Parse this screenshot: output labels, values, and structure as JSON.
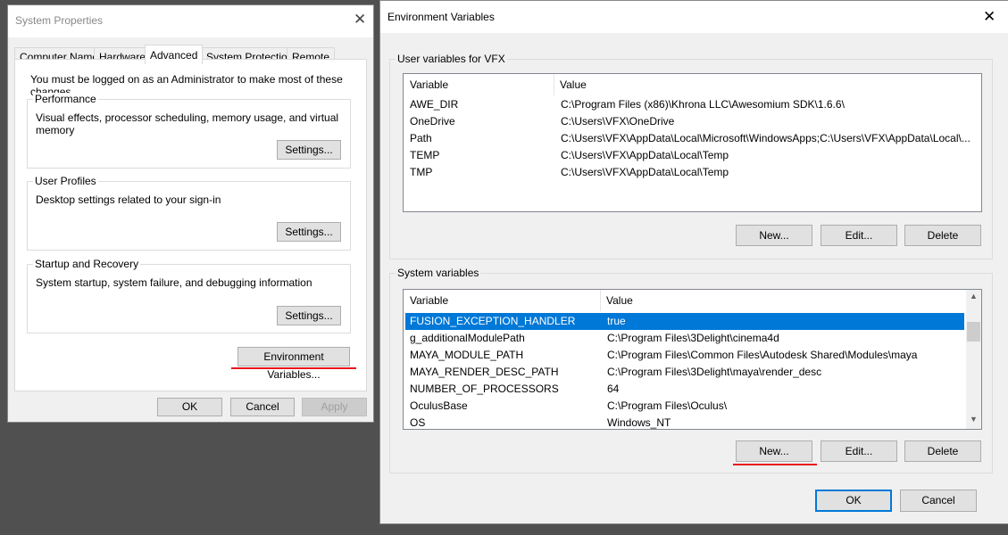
{
  "system_properties": {
    "title": "System Properties",
    "tabs": [
      "Computer Name",
      "Hardware",
      "Advanced",
      "System Protection",
      "Remote"
    ],
    "selected_tab": "Advanced",
    "admin_note": "You must be logged on as an Administrator to make most of these changes.",
    "performance": {
      "label": "Performance",
      "desc": "Visual effects, processor scheduling, memory usage, and virtual memory",
      "button": "Settings..."
    },
    "user_profiles": {
      "label": "User Profiles",
      "desc": "Desktop settings related to your sign-in",
      "button": "Settings..."
    },
    "startup": {
      "label": "Startup and Recovery",
      "desc": "System startup, system failure, and debugging information",
      "button": "Settings..."
    },
    "env_button": "Environment Variables...",
    "ok": "OK",
    "cancel": "Cancel",
    "apply": "Apply"
  },
  "env_vars": {
    "title": "Environment Variables",
    "user_group": "User variables for VFX",
    "columns": [
      "Variable",
      "Value"
    ],
    "user_vars": [
      [
        "AWE_DIR",
        "C:\\Program Files (x86)\\Khrona LLC\\Awesomium SDK\\1.6.6\\"
      ],
      [
        "OneDrive",
        "C:\\Users\\VFX\\OneDrive"
      ],
      [
        "Path",
        "C:\\Users\\VFX\\AppData\\Local\\Microsoft\\WindowsApps;C:\\Users\\VFX\\AppData\\Local\\..."
      ],
      [
        "TEMP",
        "C:\\Users\\VFX\\AppData\\Local\\Temp"
      ],
      [
        "TMP",
        "C:\\Users\\VFX\\AppData\\Local\\Temp"
      ]
    ],
    "system_group": "System variables",
    "system_vars": [
      [
        "FUSION_EXCEPTION_HANDLER",
        "true"
      ],
      [
        "g_additionalModulePath",
        "C:\\Program Files\\3Delight\\cinema4d"
      ],
      [
        "MAYA_MODULE_PATH",
        "C:\\Program Files\\Common Files\\Autodesk Shared\\Modules\\maya"
      ],
      [
        "MAYA_RENDER_DESC_PATH",
        "C:\\Program Files\\3Delight\\maya\\render_desc"
      ],
      [
        "NUMBER_OF_PROCESSORS",
        "64"
      ],
      [
        "OculusBase",
        "C:\\Program Files\\Oculus\\"
      ],
      [
        "OS",
        "Windows_NT"
      ]
    ],
    "selected_system_var": "FUSION_EXCEPTION_HANDLER",
    "new": "New...",
    "edit": "Edit...",
    "delete": "Delete",
    "ok": "OK",
    "cancel": "Cancel"
  },
  "colors": {
    "selection": "#0078d7",
    "highlight_underline": "#e8141b"
  }
}
